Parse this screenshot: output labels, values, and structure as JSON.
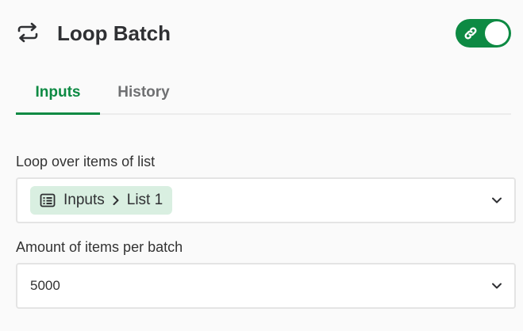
{
  "header": {
    "title": "Loop Batch",
    "icon": "loop-icon",
    "toggle_icon": "link-icon",
    "toggle_on": true,
    "accent": "#0d8a43"
  },
  "tabs": [
    {
      "label": "Inputs",
      "active": true
    },
    {
      "label": "History",
      "active": false
    }
  ],
  "fields": {
    "loop_list": {
      "label": "Loop over items of list",
      "chip": {
        "icon": "list-icon",
        "parent": "Inputs",
        "child": "List 1"
      }
    },
    "batch_size": {
      "label": "Amount of items per batch",
      "value": "5000"
    }
  }
}
